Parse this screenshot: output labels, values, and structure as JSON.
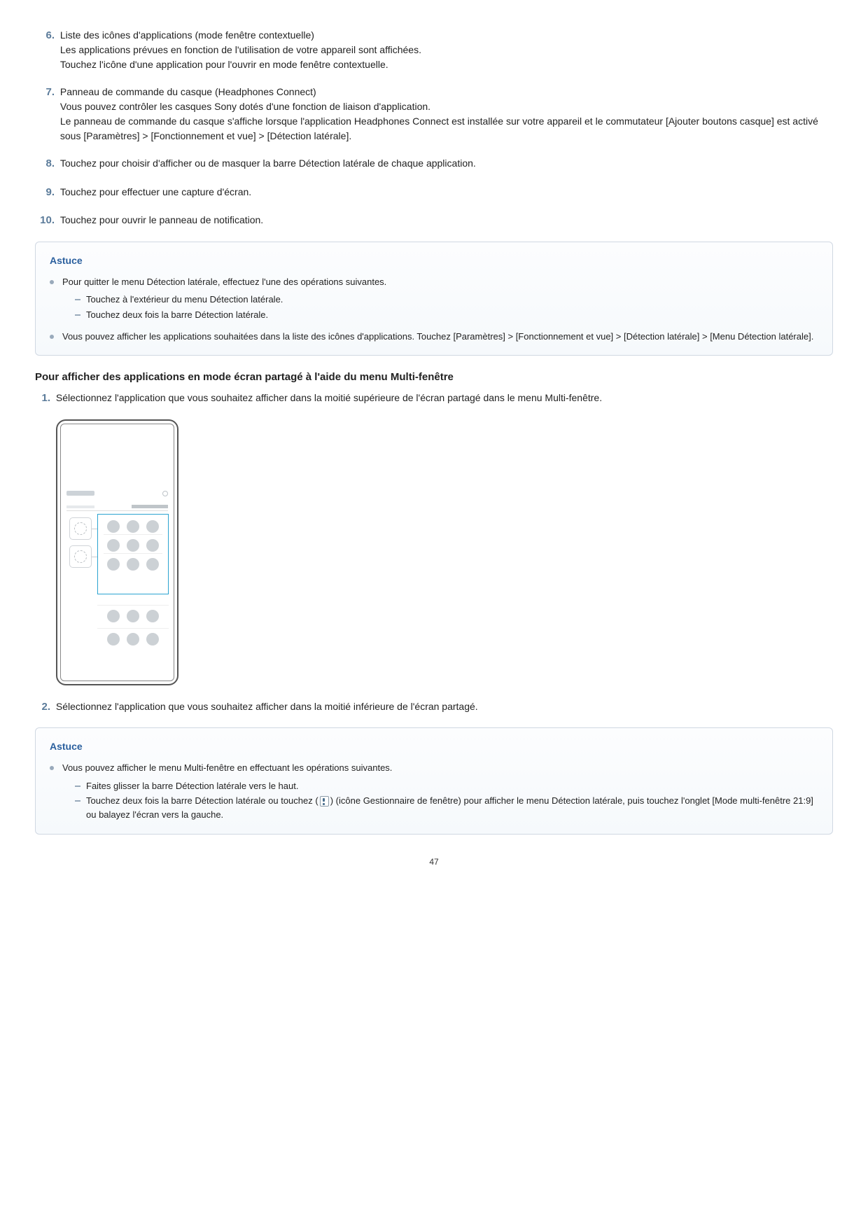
{
  "items": {
    "6": {
      "title": "Liste des icônes d'applications (mode fenêtre contextuelle)",
      "p1": "Les applications prévues en fonction de l'utilisation de votre appareil sont affichées.",
      "p2": "Touchez l'icône d'une application pour l'ouvrir en mode fenêtre contextuelle."
    },
    "7": {
      "title": "Panneau de commande du casque (Headphones Connect)",
      "p1": "Vous pouvez contrôler les casques Sony dotés d'une fonction de liaison d'application.",
      "p2": "Le panneau de commande du casque s'affiche lorsque l'application Headphones Connect est installée sur votre appareil et le commutateur [Ajouter boutons casque] est activé sous [Paramètres] > [Fonctionnement et vue] > [Détection latérale]."
    },
    "8": "Touchez pour choisir d'afficher ou de masquer la barre Détection latérale de chaque application.",
    "9": "Touchez pour effectuer une capture d'écran.",
    "10": "Touchez pour ouvrir le panneau de notification."
  },
  "tip1": {
    "title": "Astuce",
    "b1": "Pour quitter le menu Détection latérale, effectuez l'une des opérations suivantes.",
    "b1d1": "Touchez à l'extérieur du menu Détection latérale.",
    "b1d2": "Touchez deux fois la barre Détection latérale.",
    "b2": "Vous pouvez afficher les applications souhaitées dans la liste des icônes d'applications. Touchez [Paramètres] > [Fonctionnement et vue] > [Détection latérale] > [Menu Détection latérale]."
  },
  "section_heading": "Pour afficher des applications en mode écran partagé à l'aide du menu Multi-fenêtre",
  "steps": {
    "1": "Sélectionnez l'application que vous souhaitez afficher dans la moitié supérieure de l'écran partagé dans le menu Multi-fenêtre.",
    "2": "Sélectionnez l'application que vous souhaitez afficher dans la moitié inférieure de l'écran partagé."
  },
  "tip2": {
    "title": "Astuce",
    "b1": "Vous pouvez afficher le menu Multi-fenêtre en effectuant les opérations suivantes.",
    "b1d1": "Faites glisser la barre Détection latérale vers le haut.",
    "b1d2a": "Touchez deux fois la barre Détection latérale ou touchez ",
    "b1d2b": " (icône Gestionnaire de fenêtre) pour afficher le menu Détection latérale, puis touchez l'onglet [Mode multi-fenêtre 21:9] ou balayez l'écran vers la gauche."
  },
  "page_number": "47",
  "nums": {
    "6": "6.",
    "7": "7.",
    "8": "8.",
    "9": "9.",
    "10": "10.",
    "1": "1.",
    "2": "2."
  }
}
